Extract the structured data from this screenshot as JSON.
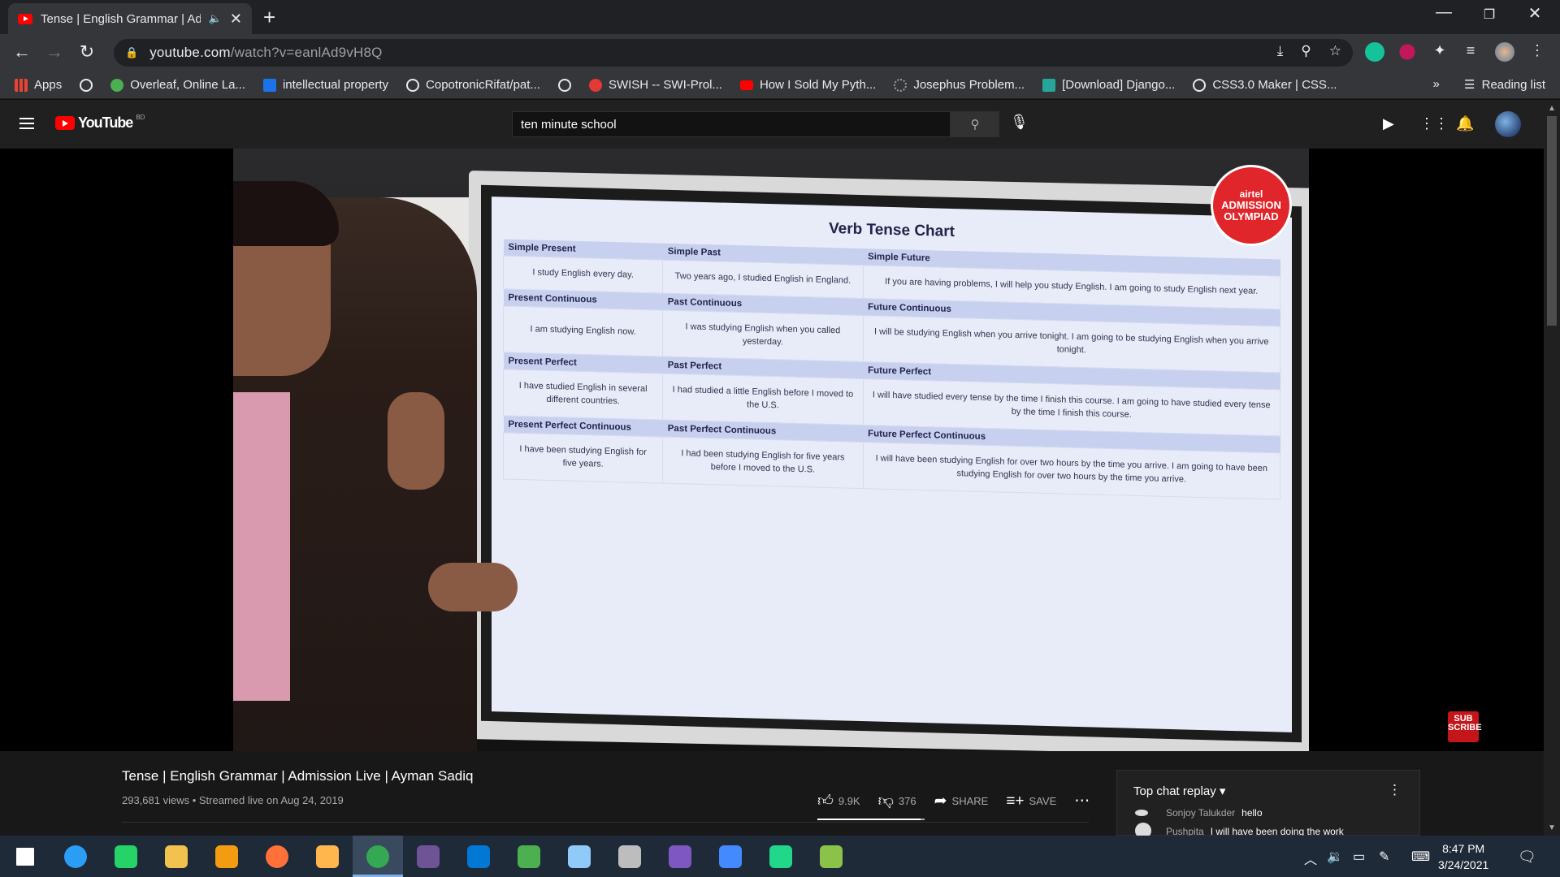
{
  "browser": {
    "tab_title": "Tense | English Grammar | Ad",
    "url_host": "youtube.com",
    "url_path": "/watch?v=eanlAd9vH8Q",
    "bookmarks": [
      {
        "label": "Apps",
        "color": "#ea4335"
      },
      {
        "label": "",
        "color": "#e8eaed"
      },
      {
        "label": "Overleaf, Online La...",
        "color": "#4caf50"
      },
      {
        "label": "intellectual property",
        "color": "#1a73e8"
      },
      {
        "label": "CopotronicRifat/pat...",
        "color": "#e8eaed"
      },
      {
        "label": "",
        "color": "#e8eaed"
      },
      {
        "label": "SWISH -- SWI-Prol...",
        "color": "#e53935"
      },
      {
        "label": "How I Sold My Pyth...",
        "color": "#ff0000"
      },
      {
        "label": "Josephus Problem...",
        "color": "#9aa0a6"
      },
      {
        "label": "[Download] Django...",
        "color": "#26a69a"
      },
      {
        "label": "CSS3.0 Maker | CSS...",
        "color": "#e8eaed"
      }
    ],
    "more_bookmarks": "»",
    "reading_list": "Reading list"
  },
  "youtube": {
    "logo_text": "YouTube",
    "country_code": "BD",
    "search_value": "ten minute school",
    "video": {
      "chart_title": "Verb Tense Chart",
      "headers": [
        [
          "Simple Present",
          "Simple Past",
          "Simple Future"
        ],
        [
          "Present Continuous",
          "Past Continuous",
          "Future Continuous"
        ],
        [
          "Present Perfect",
          "Past Perfect",
          "Future Perfect"
        ],
        [
          "Present Perfect Continuous",
          "Past Perfect Continuous",
          "Future Perfect Continuous"
        ]
      ],
      "rows": [
        [
          "I study English every day.",
          "Two years ago, I studied English in England.",
          "If you are having problems, I will help you study English. I am going to study English next year."
        ],
        [
          "I am studying English now.",
          "I was studying English when you called yesterday.",
          "I will be studying English when you arrive tonight. I am going to be studying English when you arrive tonight."
        ],
        [
          "I have studied English in several different countries.",
          "I had studied a little English before I moved to the U.S.",
          "I will have studied every tense by the time I finish this course. I am going to have studied every tense by the time I finish this course."
        ],
        [
          "I have been studying English for five years.",
          "I had been studying English for five years before I moved to the U.S.",
          "I will have been studying English for over two hours by the time you arrive. I am going to have been studying English for over two hours by the time you arrive."
        ]
      ],
      "badge_line1": "airtel",
      "badge_line2": "ADMISSION OLYMPIAD",
      "subscribe": "SUB SCRIBE"
    },
    "title": "Tense | English Grammar | Admission Live | Ayman Sadiq",
    "meta": "293,681 views • Streamed live on Aug 24, 2019",
    "likes": "9.9K",
    "dislikes": "376",
    "share": "SHARE",
    "save": "SAVE",
    "like_ratio": 0.96,
    "chat": {
      "header": "Top chat replay",
      "messages": [
        {
          "author": "Sonjoy Talukder",
          "text": "hello"
        },
        {
          "author": "Pushpita",
          "text": "I will have been doing the work"
        }
      ]
    }
  },
  "taskbar": {
    "time": "8:47 PM",
    "date": "3/24/2021",
    "apps": [
      {
        "name": "windows",
        "color": "#ffffff"
      },
      {
        "name": "search",
        "color": "#2a9df4"
      },
      {
        "name": "whatsapp",
        "color": "#25d366"
      },
      {
        "name": "file-explorer",
        "color": "#f2c14e"
      },
      {
        "name": "vpn",
        "color": "#f39c12"
      },
      {
        "name": "firefox",
        "color": "#ff7139"
      },
      {
        "name": "app-orange",
        "color": "#ffb74d"
      },
      {
        "name": "chrome",
        "color": "#34a853"
      },
      {
        "name": "github",
        "color": "#6e5494"
      },
      {
        "name": "vscode",
        "color": "#0078d4"
      },
      {
        "name": "app-green",
        "color": "#4caf50"
      },
      {
        "name": "app-blue",
        "color": "#90caf9"
      },
      {
        "name": "app-satellite",
        "color": "#bdbdbd"
      },
      {
        "name": "visual-studio",
        "color": "#7e57c2"
      },
      {
        "name": "messenger",
        "color": "#448aff"
      },
      {
        "name": "pycharm",
        "color": "#21d789"
      },
      {
        "name": "app-editor",
        "color": "#8bc34a"
      }
    ]
  }
}
